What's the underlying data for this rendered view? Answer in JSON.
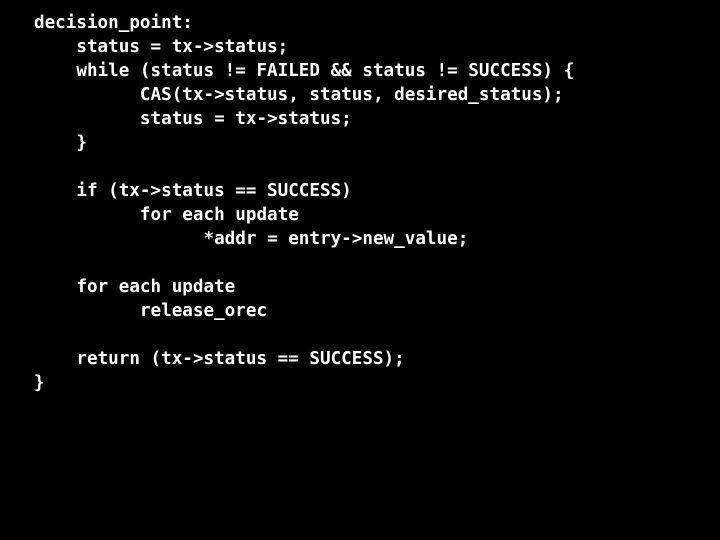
{
  "slide": {
    "background_color": "#000000",
    "text_color": "#FFFFFF",
    "kind": "code-listing-slide"
  },
  "code": {
    "language": "c-pseudocode",
    "indent_unit_spaces": 4,
    "lines": [
      {
        "indent": 0,
        "text": "decision_point:"
      },
      {
        "indent": 4,
        "text": "status = tx->status;"
      },
      {
        "indent": 4,
        "text": "while (status != FAILED && status != SUCCESS) {"
      },
      {
        "indent": 10,
        "text": "CAS(tx->status, status, desired_status);"
      },
      {
        "indent": 10,
        "text": "status = tx->status;"
      },
      {
        "indent": 4,
        "text": "}"
      },
      {
        "indent": 0,
        "text": ""
      },
      {
        "indent": 4,
        "text": "if (tx->status == SUCCESS)"
      },
      {
        "indent": 10,
        "text": "for each update"
      },
      {
        "indent": 16,
        "text": "*addr = entry->new_value;"
      },
      {
        "indent": 0,
        "text": ""
      },
      {
        "indent": 4,
        "text": "for each update"
      },
      {
        "indent": 10,
        "text": "release_orec"
      },
      {
        "indent": 0,
        "text": ""
      },
      {
        "indent": 4,
        "text": "return (tx->status == SUCCESS);"
      },
      {
        "indent": 0,
        "text": "}"
      }
    ]
  }
}
